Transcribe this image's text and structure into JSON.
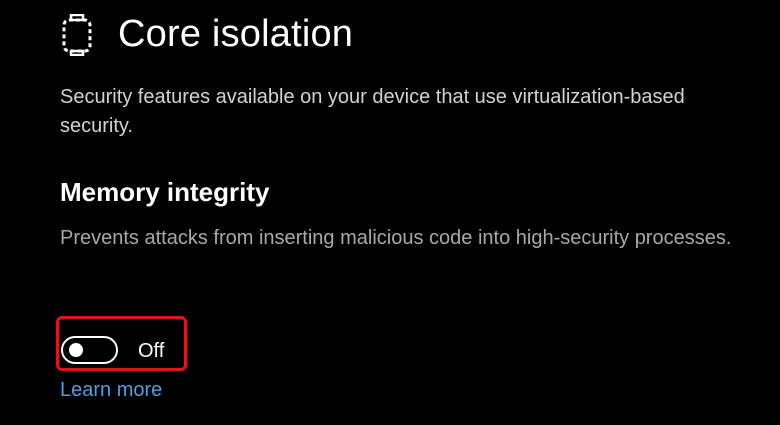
{
  "header": {
    "icon": "core-isolation-chip-icon",
    "title": "Core isolation",
    "description": "Security features available on your device that use virtualization-based security."
  },
  "memory_integrity": {
    "heading": "Memory integrity",
    "description": "Prevents attacks from inserting malicious code into high-security processes.",
    "toggle_state": "Off",
    "toggle_on": false,
    "learn_more_label": "Learn more"
  },
  "colors": {
    "background": "#000000",
    "text_primary": "#ffffff",
    "text_secondary": "#a8a8a8",
    "link": "#4c9ee6",
    "highlight": "#e0141e"
  }
}
